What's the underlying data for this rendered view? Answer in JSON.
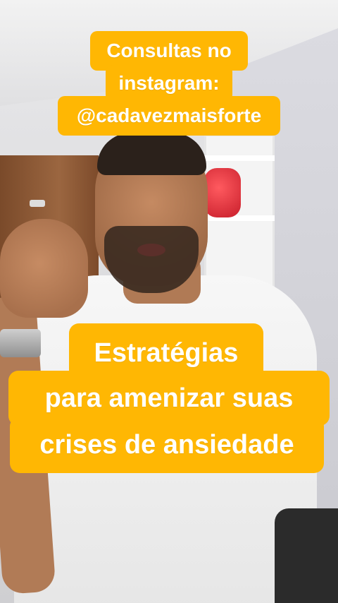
{
  "overlay": {
    "top_caption": {
      "line1": "Consultas no",
      "line2": "instagram:",
      "line3": "@cadavezmaisforte"
    },
    "bottom_caption": {
      "line1": "Estratégias",
      "line2": "para amenizar suas",
      "line3": "crises de ansiedade"
    }
  },
  "colors": {
    "caption_bg": "#ffb703",
    "caption_text": "#ffffff"
  }
}
